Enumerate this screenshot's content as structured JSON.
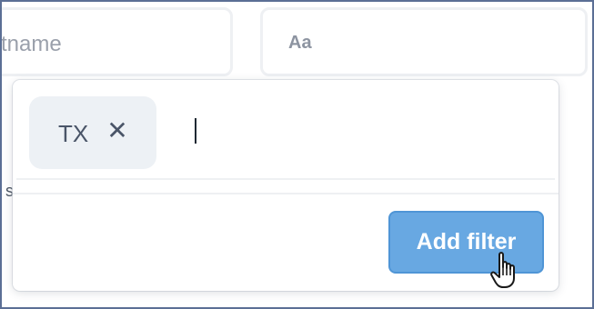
{
  "background_fields": {
    "left_text": "stname",
    "right_placeholder": "Aa"
  },
  "stray_text": "s",
  "filter_popover": {
    "tokens": [
      {
        "label": "TX",
        "remove_glyph": "✕"
      }
    ],
    "input_value": "",
    "add_button_label": "Add filter"
  },
  "colors": {
    "accent": "#68a8e2",
    "token_bg": "#edf1f5",
    "frame": "#5b6f95"
  },
  "icons": {
    "remove": "close-icon",
    "pointer": "hand-pointer-cursor-icon"
  }
}
